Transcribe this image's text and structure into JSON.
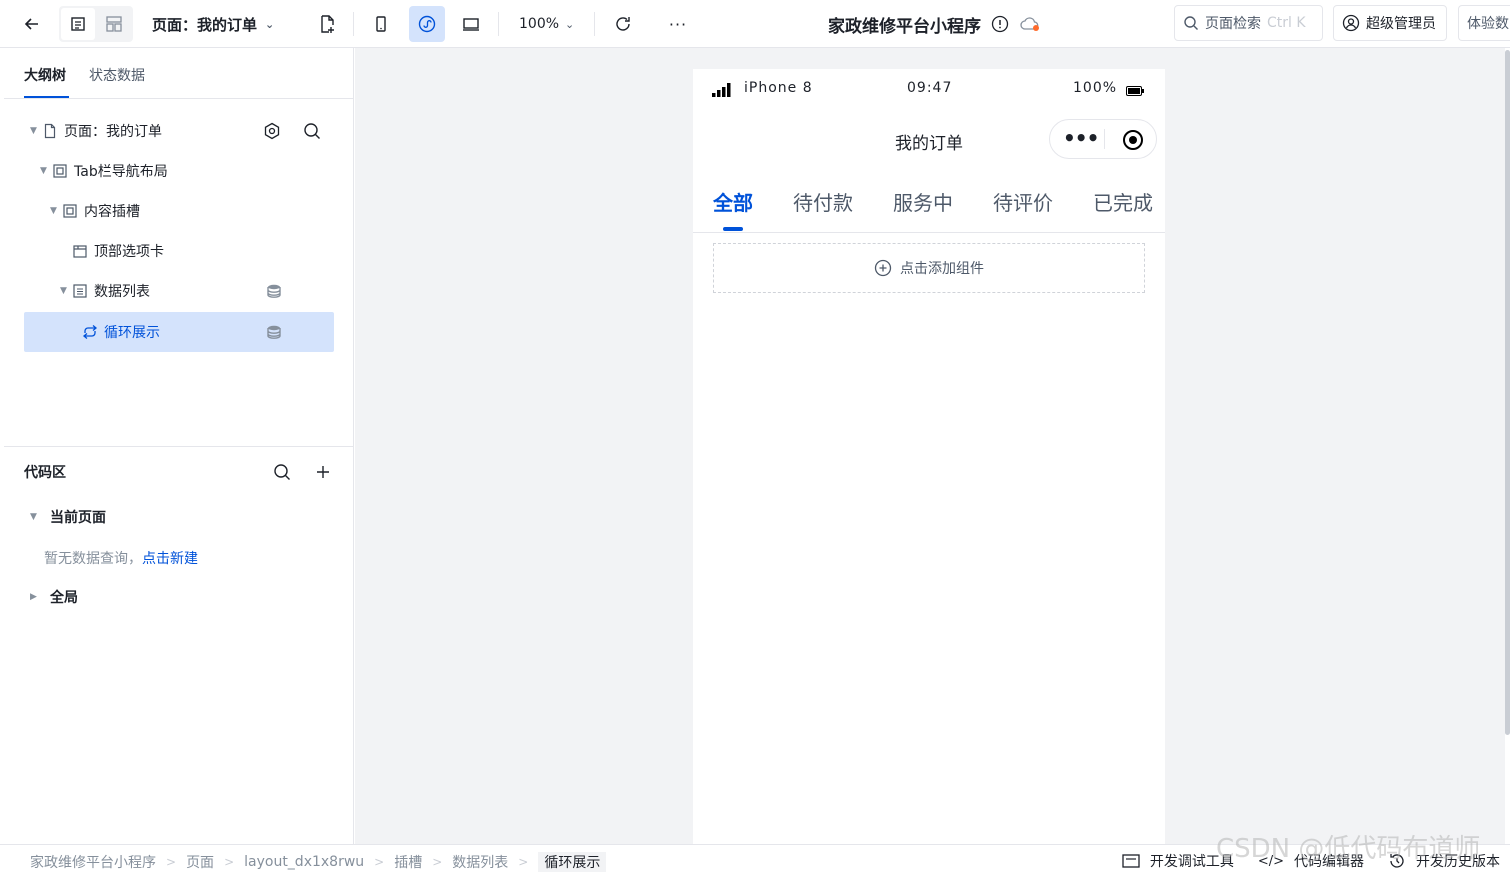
{
  "toolbar": {
    "page_selector": "页面：我的订单",
    "zoom": "100%",
    "app_title": "家政维修平台小程序",
    "search_label": "页面检索",
    "search_shortcut": "Ctrl K",
    "admin_label": "超级管理员",
    "trial_label": "体验数"
  },
  "left_panel": {
    "tabs": [
      "大纲树",
      "状态数据"
    ],
    "tree": [
      {
        "label": "页面：我的订单"
      },
      {
        "label": "Tab栏导航布局"
      },
      {
        "label": "内容插槽"
      },
      {
        "label": "顶部选项卡"
      },
      {
        "label": "数据列表"
      },
      {
        "label": "循环展示"
      }
    ],
    "code_area": {
      "title": "代码区",
      "current_page": "当前页面",
      "empty_text": "暂无数据查询，",
      "create_link": "点击新建",
      "global": "全局"
    }
  },
  "phone": {
    "carrier": "iPhone 8",
    "time": "09:47",
    "battery": "100%",
    "title": "我的订单",
    "tabs": [
      "全部",
      "待付款",
      "服务中",
      "待评价",
      "已完成"
    ],
    "active_tab": "全部",
    "add_component": "点击添加组件"
  },
  "breadcrumb": [
    "家政维修平台小程序",
    "页面",
    "layout_dx1x8rwu",
    "插槽",
    "数据列表",
    "循环展示"
  ],
  "bottom_tools": [
    "开发调试工具",
    "代码编辑器",
    "开发历史版本"
  ],
  "watermark": "CSDN @低代码布道师",
  "colors": {
    "accent": "#0052d9",
    "selected_bg": "#d4e3fc",
    "canvas_bg": "#f2f3f5"
  }
}
